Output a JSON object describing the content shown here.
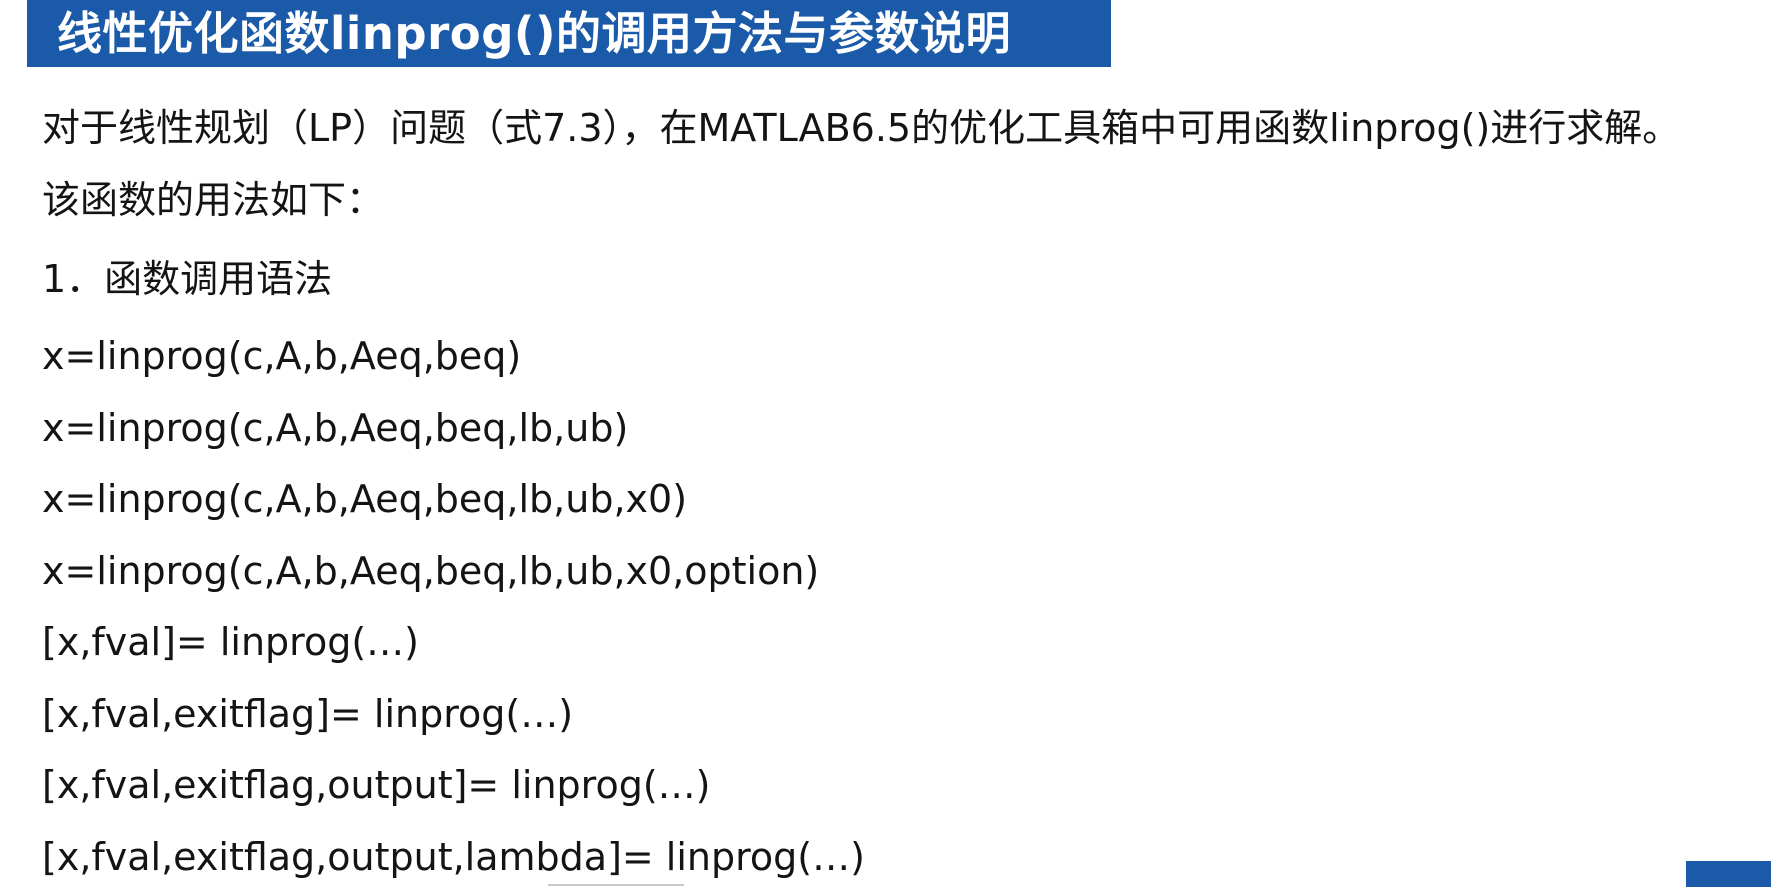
{
  "title": "线性优化函数linprog()的调用方法与参数说明",
  "intro": {
    "line1": "对于线性规划（LP）问题（式7.3），在MATLAB6.5的优化工具箱中可用函数linprog()进行求解。",
    "line2": "该函数的用法如下："
  },
  "section_heading": "1．函数调用语法",
  "syntax_lines": [
    "x=linprog(c,A,b,Aeq,beq)",
    "x=linprog(c,A,b,Aeq,beq,lb,ub)",
    "x=linprog(c,A,b,Aeq,beq,lb,ub,x0)",
    "x=linprog(c,A,b,Aeq,beq,lb,ub,x0,option)",
    "[x,fval]= linprog(…)",
    "[x,fval,exitflag]= linprog(…)",
    "[x,fval,exitflag,output]= linprog(…)",
    "[x,fval,exitflag,output,lambda]= linprog(…)"
  ],
  "colors": {
    "banner": "#1a5aa8",
    "banner_text": "#ffffff",
    "body_text": "#141414"
  }
}
